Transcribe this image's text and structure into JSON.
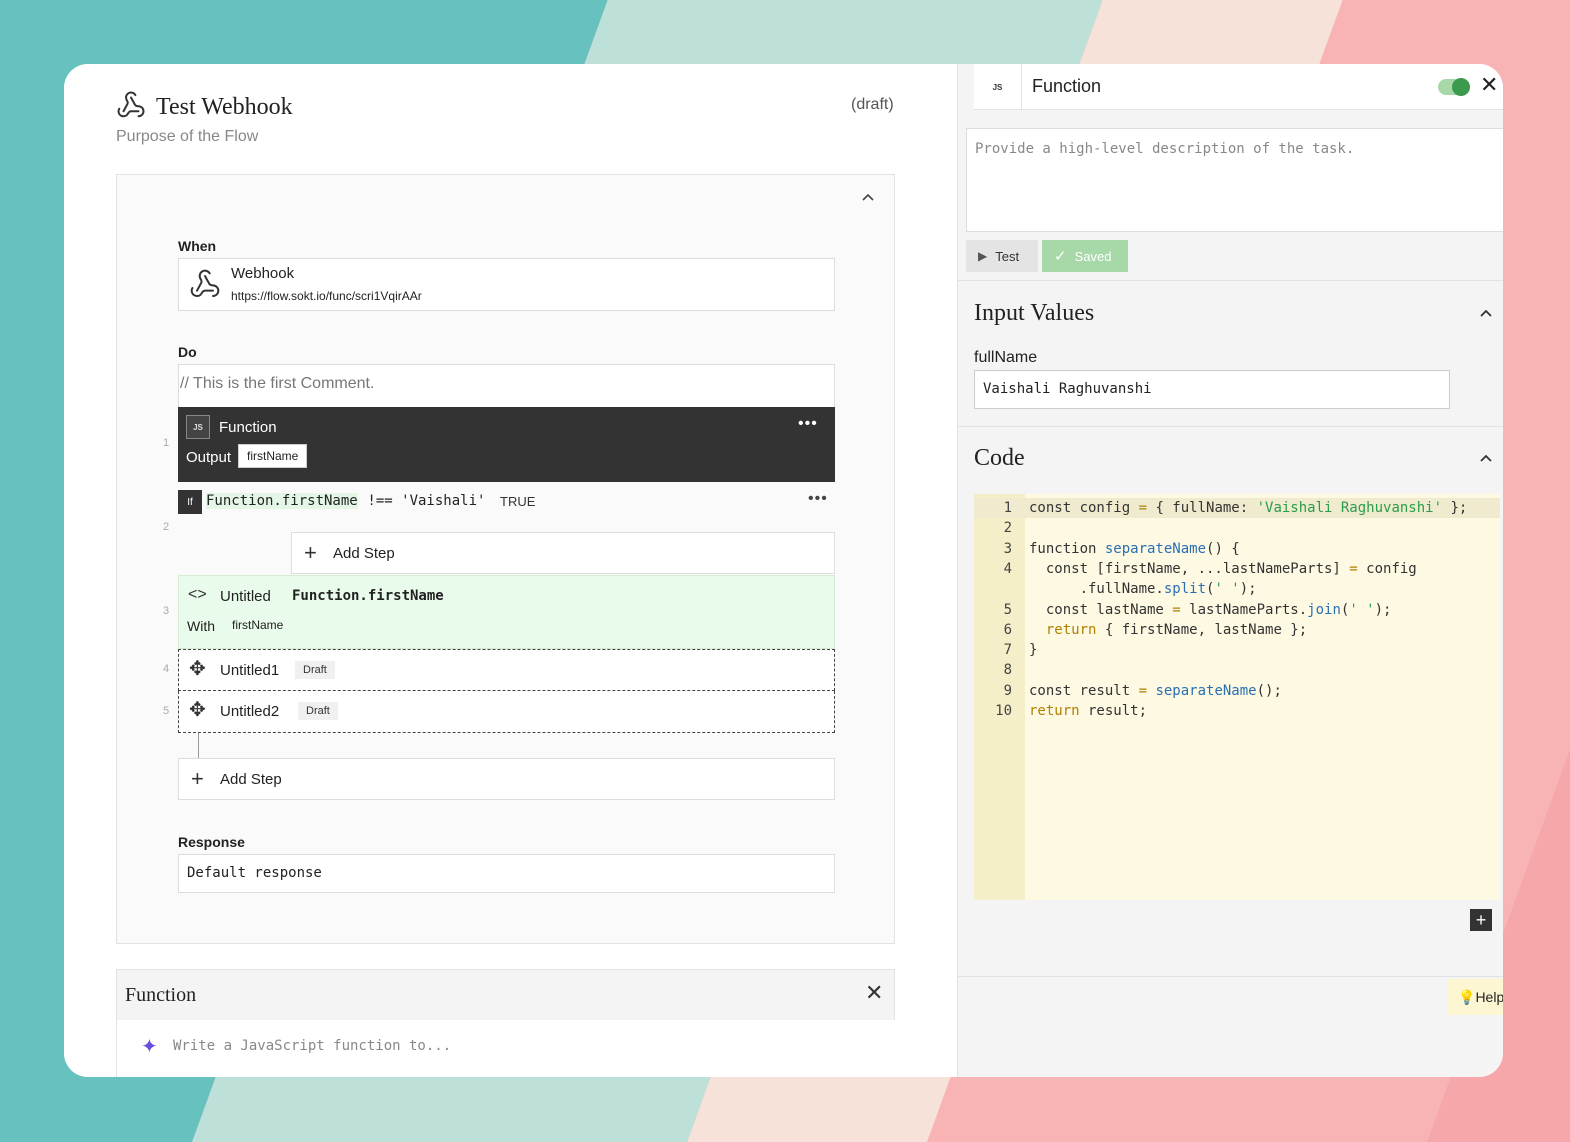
{
  "flow": {
    "title": "Test Webhook",
    "status": "(draft)",
    "purpose": "Purpose of the Flow"
  },
  "when": {
    "label": "When",
    "trigger_name": "Webhook",
    "trigger_url": "https://flow.sokt.io/func/scri1VqirAAr"
  },
  "do": {
    "label": "Do",
    "comment": "// This is the first Comment.",
    "steps": [
      {
        "num": "1",
        "type_badge": "JS",
        "name": "Function",
        "output_label": "Output",
        "output_value": "firstName"
      },
      {
        "num": "2",
        "if_badge": "If",
        "condition_var": "Function.firstName",
        "condition_rest": " !== 'Vaishali'",
        "result": "TRUE",
        "add_step": "Add Step"
      },
      {
        "num": "3",
        "name": "Untitled",
        "expr": "Function.firstName",
        "with_label": "With",
        "with_value": "firstName"
      },
      {
        "num": "4",
        "name": "Untitled1",
        "badge": "Draft"
      },
      {
        "num": "5",
        "name": "Untitled2",
        "badge": "Draft"
      }
    ],
    "add_step": "Add Step"
  },
  "response": {
    "label": "Response",
    "value": "Default response"
  },
  "bottom_panel": {
    "title": "Function",
    "placeholder": "Write a JavaScript function to..."
  },
  "right_panel": {
    "type_badge": "JS",
    "title": "Function",
    "toggle_on": true,
    "description_placeholder": "Provide a high-level description of the task.",
    "test_label": "Test",
    "saved_label": "Saved",
    "input_values_title": "Input Values",
    "input_field_label": "fullName",
    "input_field_value": "Vaishali Raghuvanshi",
    "code_title": "Code",
    "help_label": "Help",
    "code_lines": [
      {
        "n": "1",
        "text": "const config = { fullName: 'Vaishali Raghuvanshi' };"
      },
      {
        "n": "2",
        "text": ""
      },
      {
        "n": "3",
        "text": "function separateName() {"
      },
      {
        "n": "4",
        "text": "  const [firstName, ...lastNameParts] = config"
      },
      {
        "n": "",
        "text": "      .fullName.split(' ');"
      },
      {
        "n": "5",
        "text": "  const lastName = lastNameParts.join(' ');"
      },
      {
        "n": "6",
        "text": "  return { firstName, lastName };"
      },
      {
        "n": "7",
        "text": "}"
      },
      {
        "n": "8",
        "text": ""
      },
      {
        "n": "9",
        "text": "const result = separateName();"
      },
      {
        "n": "10",
        "text": "return result;"
      }
    ]
  },
  "colors": {
    "accent_green": "#3c9a4c",
    "saved_bg": "#a6d8a8",
    "function_block_bg": "#333333",
    "expression_step_bg": "#e9fbea",
    "code_bg": "#fdf9e3",
    "help_bg": "#fdf6d3"
  }
}
